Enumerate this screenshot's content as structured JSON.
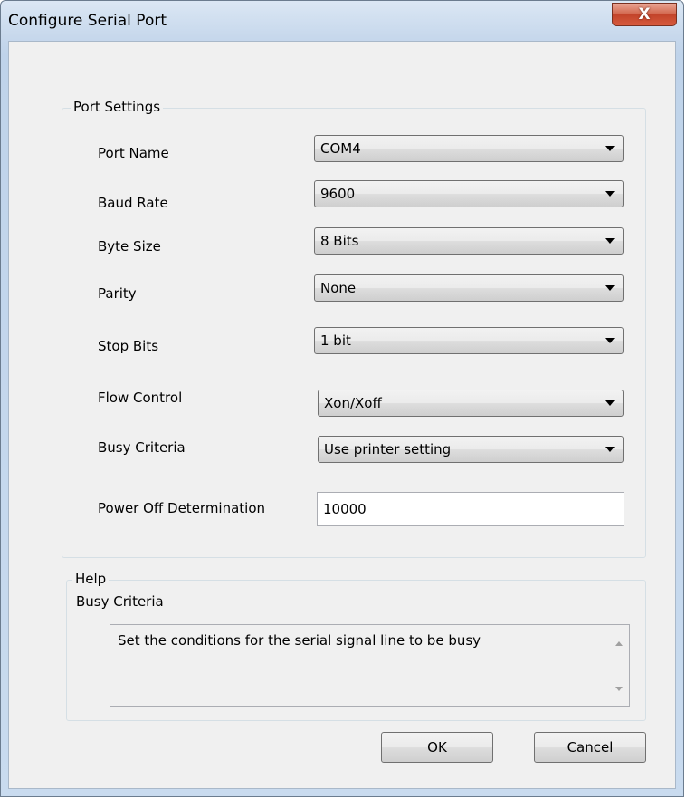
{
  "window": {
    "title": "Configure Serial Port",
    "close_glyph": "X"
  },
  "port_settings": {
    "legend": "Port Settings",
    "fields": [
      {
        "label": "Port Name",
        "value": "COM4"
      },
      {
        "label": "Baud Rate",
        "value": "9600"
      },
      {
        "label": "Byte Size",
        "value": "8 Bits"
      },
      {
        "label": "Parity",
        "value": "None"
      },
      {
        "label": "Stop Bits",
        "value": "1 bit"
      },
      {
        "label": "Flow Control",
        "value": "Xon/Xoff"
      },
      {
        "label": "Busy Criteria",
        "value": "Use printer setting"
      }
    ],
    "power_off": {
      "label": "Power Off Determination",
      "value": "10000"
    }
  },
  "help": {
    "legend": "Help",
    "topic": "Busy Criteria",
    "text": "Set the conditions for the serial signal line to be busy"
  },
  "buttons": {
    "ok": "OK",
    "cancel": "Cancel"
  }
}
